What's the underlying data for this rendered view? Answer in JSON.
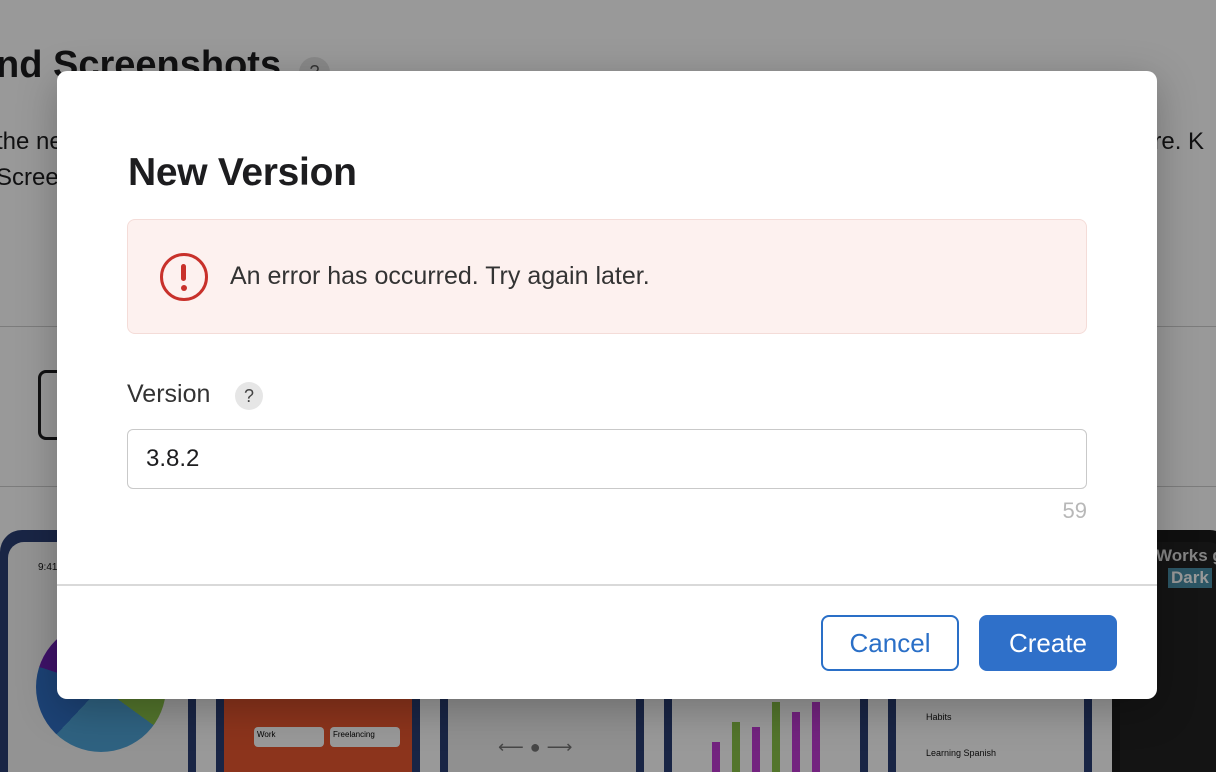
{
  "background": {
    "heading": "nd Screenshots",
    "help_glyph": "?",
    "line1_left": "the ne",
    "line1_right": "ore. K",
    "line2_left": "Scree",
    "shot_labels": {
      "time": "9:41",
      "work": "Work",
      "freelancing": "Freelancing",
      "habits": "Habits",
      "spanish": "Learning Spanish",
      "dark_title": "Works g",
      "dark_badge": "Dark"
    }
  },
  "dialog": {
    "title": "New Version",
    "error": {
      "message": "An error has occurred. Try again later.",
      "icon": "exclamation-circle-icon",
      "color": "#c8312b"
    },
    "version_field": {
      "label": "Version",
      "help_glyph": "?",
      "value": "3.8.2",
      "remaining_chars": "59"
    },
    "buttons": {
      "cancel": "Cancel",
      "create": "Create"
    },
    "accent_color": "#2f70c9"
  }
}
